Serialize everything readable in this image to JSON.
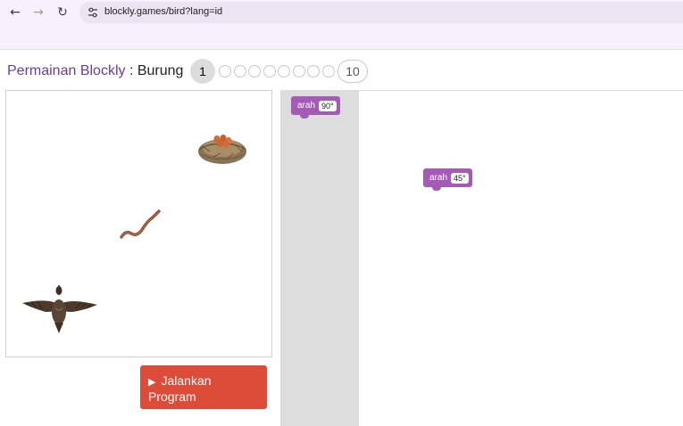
{
  "browser": {
    "url": "blockly.games/bird?lang=id"
  },
  "header": {
    "game_title": "Permainan Blockly",
    "separator": " : ",
    "level_title": "Burung",
    "current_level": "1",
    "last_level": "10",
    "total_levels": 10
  },
  "visualization": {
    "sprites": [
      "nest-icon",
      "worm-icon",
      "bird-icon"
    ]
  },
  "run_button": {
    "icon": "play-icon",
    "label": "Jalankan Program"
  },
  "toolbox": {
    "block": {
      "label": "arah",
      "value": "90°"
    }
  },
  "workspace": {
    "block": {
      "label": "arah",
      "value": "45°"
    }
  },
  "colors": {
    "block": "#a55ab8",
    "run_button": "#dd4b39",
    "toolbox_bg": "#dddddd",
    "title_link": "#6a3d9a"
  }
}
